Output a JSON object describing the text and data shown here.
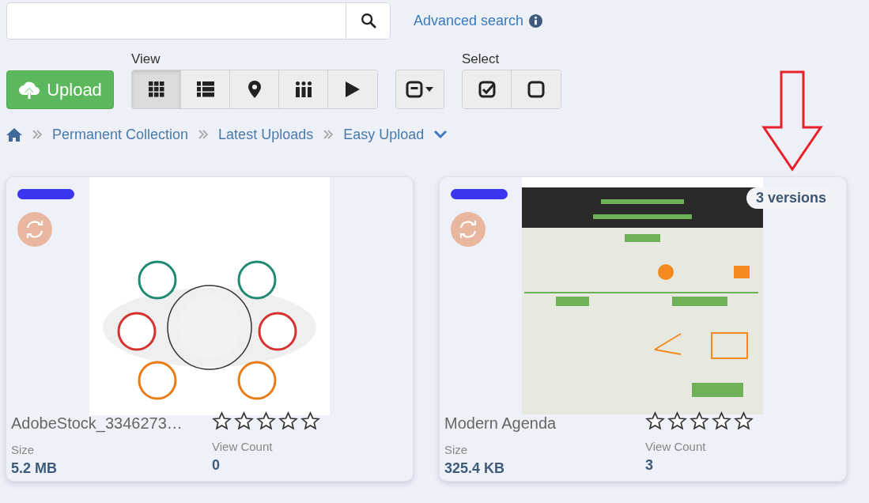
{
  "search": {
    "advanced_link": "Advanced search"
  },
  "toolbar": {
    "upload_label": "Upload",
    "view_label": "View",
    "select_label": "Select",
    "view_buttons": [
      {
        "kind": "grid",
        "selected": true
      },
      {
        "kind": "list",
        "selected": false
      },
      {
        "kind": "map",
        "selected": false
      },
      {
        "kind": "columns",
        "selected": false
      },
      {
        "kind": "slideshow",
        "selected": false
      }
    ]
  },
  "breadcrumb": [
    {
      "label": "Permanent Collection"
    },
    {
      "label": "Latest Uploads"
    },
    {
      "label": "Easy Upload"
    }
  ],
  "cards": [
    {
      "name": "AdobeStock_3346273…",
      "stars": 0,
      "size_label": "Size",
      "size": "5.2 MB",
      "count_label": "View Count",
      "count": "0"
    },
    {
      "name": "Modern Agenda",
      "versions": "3 versions",
      "stars": 0,
      "size_label": "Size",
      "size": "325.4 KB",
      "count_label": "View Count",
      "count": "3"
    }
  ]
}
